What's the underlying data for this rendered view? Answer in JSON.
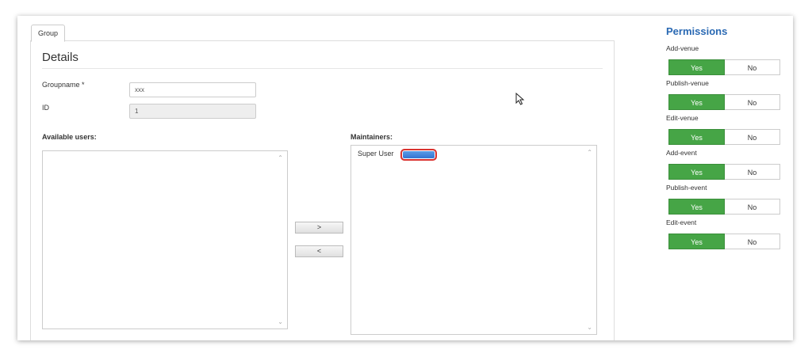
{
  "tab": {
    "label": "Group"
  },
  "details": {
    "title": "Details",
    "groupname_label": "Groupname *",
    "groupname_value": "xxx",
    "id_label": "ID",
    "id_value": "1"
  },
  "available_users": {
    "label": "Available users:",
    "items": []
  },
  "maintainers": {
    "label": "Maintainers:",
    "items": [
      "Super User"
    ]
  },
  "buttons": {
    "add_label": ">",
    "remove_label": "<"
  },
  "permissions": {
    "title": "Permissions",
    "yes_label": "Yes",
    "no_label": "No",
    "selected_color": "#46a546",
    "items": [
      {
        "label": "Add-venue",
        "value": "Yes"
      },
      {
        "label": "Publish-venue",
        "value": "Yes"
      },
      {
        "label": "Edit-venue",
        "value": "Yes"
      },
      {
        "label": "Add-event",
        "value": "Yes"
      },
      {
        "label": "Publish-event",
        "value": "Yes"
      },
      {
        "label": "Edit-event",
        "value": "Yes"
      }
    ]
  }
}
